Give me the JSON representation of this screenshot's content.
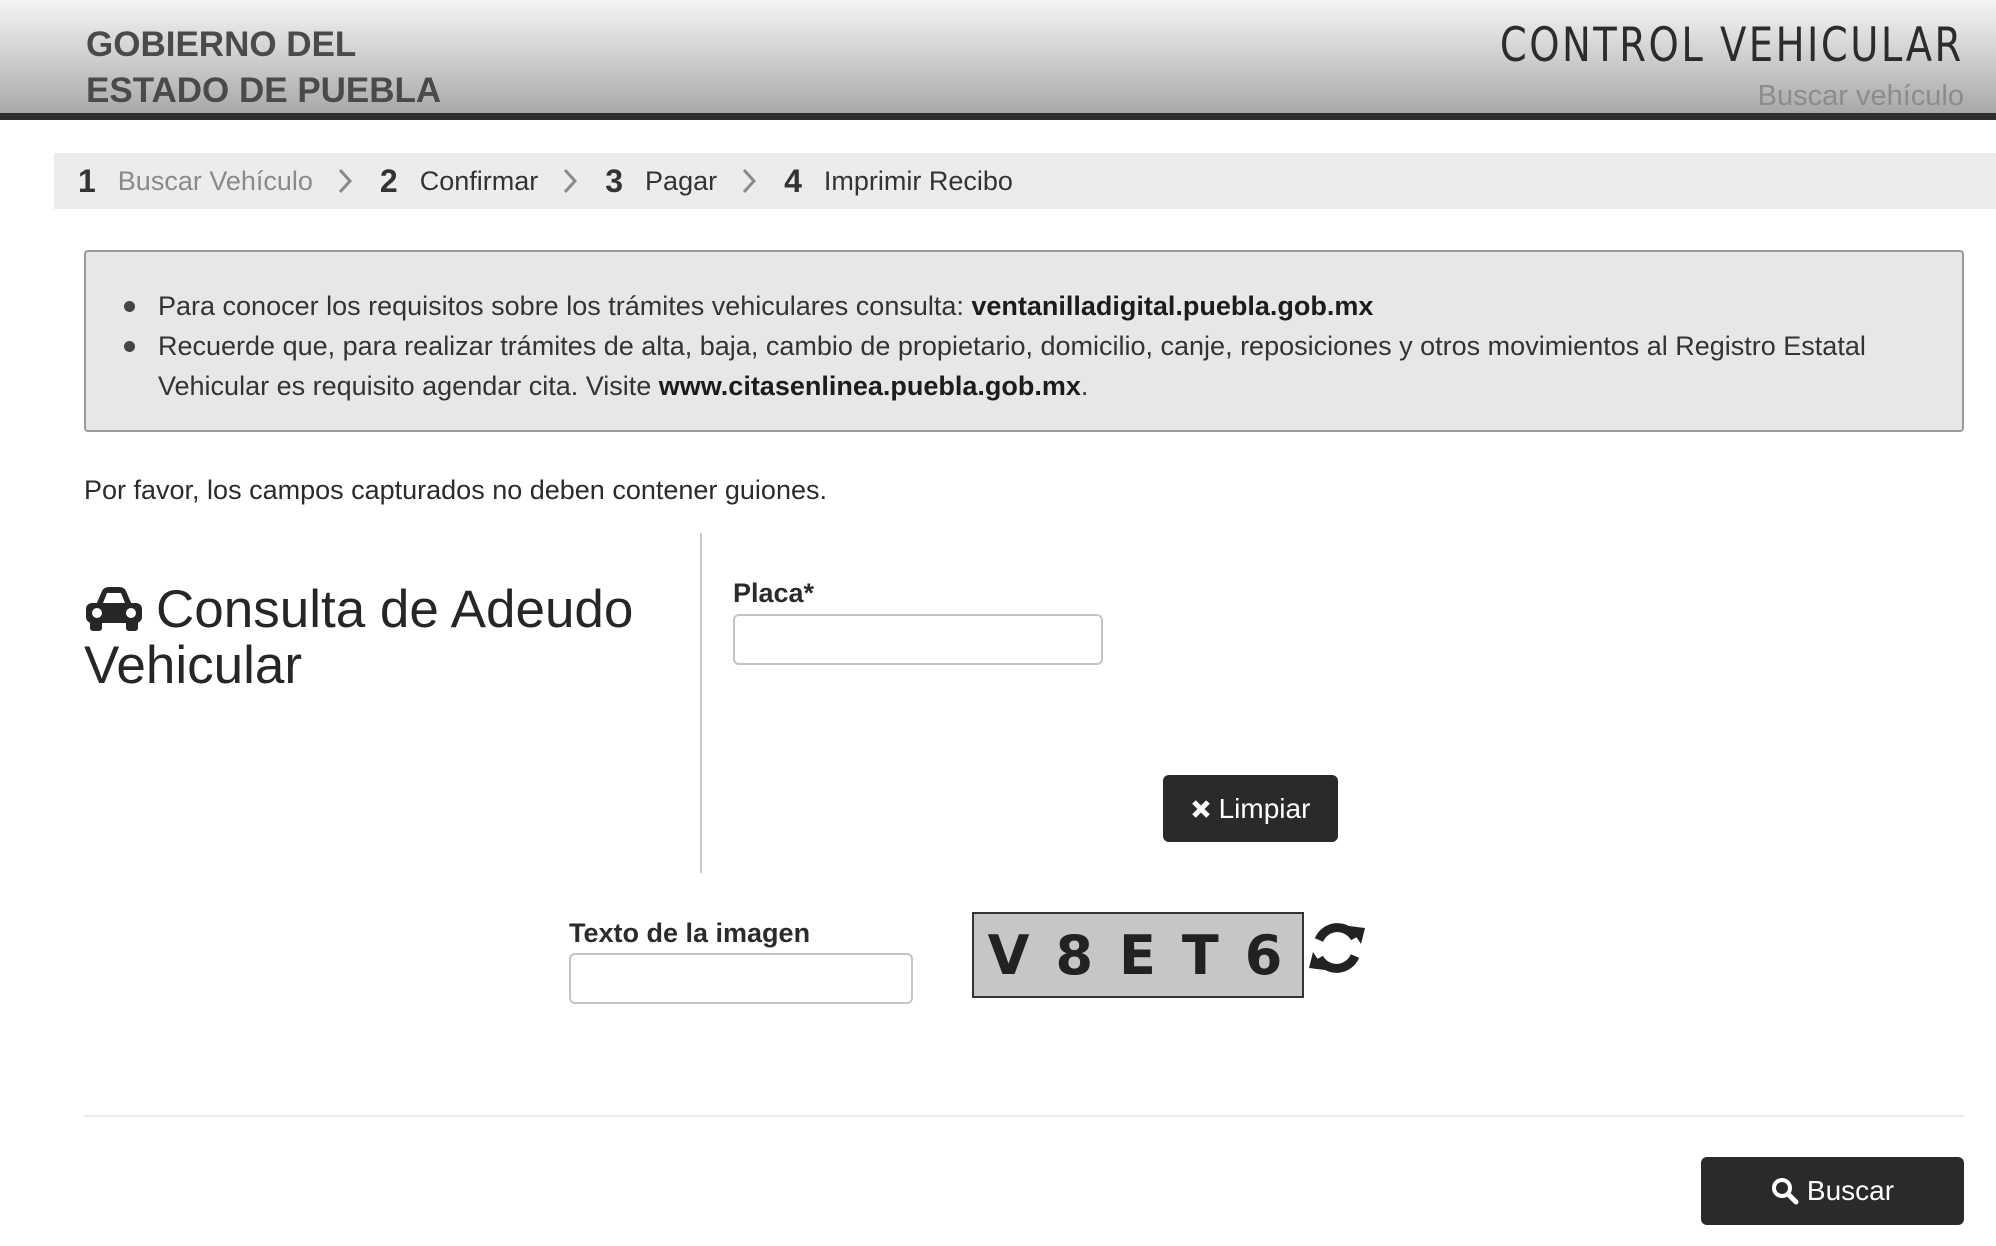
{
  "header": {
    "gov_line1": "GOBIERNO DEL",
    "gov_line2": "ESTADO DE PUEBLA",
    "app_title": "CONTROL VEHICULAR",
    "app_subtitle": "Buscar vehículo"
  },
  "steps": [
    {
      "num": "1",
      "label": "Buscar Vehículo",
      "active": true
    },
    {
      "num": "2",
      "label": "Confirmar"
    },
    {
      "num": "3",
      "label": "Pagar"
    },
    {
      "num": "4",
      "label": "Imprimir Recibo"
    }
  ],
  "info": {
    "item1_text": "Para conocer los requisitos sobre los trámites vehiculares consulta: ",
    "item1_link": "ventanilladigital.puebla.gob.mx",
    "item2_text": "Recuerde que, para realizar trámites de alta, baja, cambio de propietario, domicilio, canje, reposiciones y otros movimientos al Registro Estatal Vehicular es requisito agendar cita. Visite ",
    "item2_link": "www.citasenlinea.puebla.gob.mx",
    "item2_end": "."
  },
  "note": "Por favor, los campos capturados no deben contener guiones.",
  "form": {
    "title": "Consulta de Adeudo Vehicular",
    "placa_label": "Placa*",
    "placa_value": "",
    "limpiar_label": "Limpiar",
    "captcha_label": "Texto de la imagen",
    "captcha_value": "",
    "captcha_text": "V8ET6",
    "buscar_label": "Buscar"
  },
  "icons": {
    "car": "car-icon",
    "close": "times-icon",
    "refresh": "refresh-icon",
    "search": "search-icon",
    "chevron": "chevron-right-icon"
  }
}
